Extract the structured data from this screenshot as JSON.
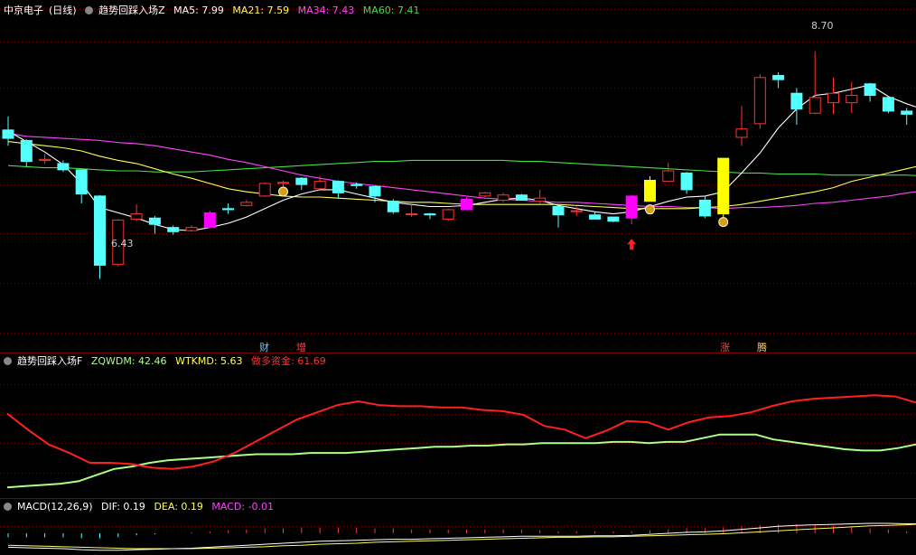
{
  "header1": {
    "stock": "中京电子",
    "period": "(日线)",
    "indicator": "趋势回踩入场Z",
    "ma5": "MA5: 7.99",
    "ma21": "MA21: 7.59",
    "ma34": "MA34: 7.43",
    "ma60": "MA60: 7.41"
  },
  "header2": {
    "indicator": "趋势回踩入场F",
    "zqwdm": "ZQWDM: 42.46",
    "wtkmd": "WTKMD: 5.63",
    "funds": "做多资金: 61.69"
  },
  "header3": {
    "indicator": "MACD(12,26,9)",
    "dif": "DIF: 0.19",
    "dea": "DEA: 0.19",
    "macd": "MACD: -0.01"
  },
  "tags": {
    "cai": "财",
    "zeng": "增",
    "zhang": "涨",
    "teng": "腾"
  },
  "colors": {
    "up": "#ff3333",
    "down": "#54ffff",
    "ma5": "#ffffff",
    "ma21": "#ffff55",
    "ma34": "#ff44ff",
    "ma60": "#44dd44",
    "grid": "#7a0000",
    "funds": "#ff2020",
    "zqwdm": "#aaff88"
  },
  "chart_data": [
    {
      "type": "candlestick",
      "ylim": [
        5.9,
        8.9
      ],
      "annotations": {
        "high": "8.70",
        "low": "6.43"
      },
      "candles": [
        [
          7.85,
          7.77,
          7.98,
          7.7
        ],
        [
          7.75,
          7.55,
          7.76,
          7.5
        ],
        [
          7.56,
          7.57,
          7.62,
          7.53
        ],
        [
          7.53,
          7.47,
          7.56,
          7.45
        ],
        [
          7.47,
          7.24,
          7.48,
          7.15
        ],
        [
          7.22,
          6.56,
          7.23,
          6.43
        ],
        [
          6.57,
          6.99,
          7.0,
          6.55
        ],
        [
          7.0,
          7.05,
          7.14,
          6.98
        ],
        [
          7.01,
          6.95,
          7.03,
          6.86
        ],
        [
          6.92,
          6.88,
          6.94,
          6.85
        ],
        [
          6.89,
          6.92,
          6.94,
          6.89
        ],
        [
          6.92,
          7.06,
          7.08,
          6.92
        ],
        [
          7.1,
          7.09,
          7.15,
          7.05
        ],
        [
          7.13,
          7.16,
          7.18,
          7.12
        ],
        [
          7.22,
          7.34,
          7.35,
          7.21
        ],
        [
          7.34,
          7.35,
          7.37,
          7.31
        ],
        [
          7.39,
          7.33,
          7.4,
          7.28
        ],
        [
          7.29,
          7.36,
          7.41,
          7.28
        ],
        [
          7.36,
          7.25,
          7.37,
          7.2
        ],
        [
          7.33,
          7.32,
          7.35,
          7.29
        ],
        [
          7.31,
          7.22,
          7.32,
          7.16
        ],
        [
          7.17,
          7.07,
          7.19,
          7.05
        ],
        [
          7.05,
          7.05,
          7.14,
          7.02
        ],
        [
          7.05,
          7.04,
          7.06,
          7.0
        ],
        [
          7.0,
          7.09,
          7.1,
          6.98
        ],
        [
          7.09,
          7.19,
          7.21,
          7.09
        ],
        [
          7.22,
          7.25,
          7.26,
          7.21
        ],
        [
          7.18,
          7.23,
          7.25,
          7.16
        ],
        [
          7.23,
          7.18,
          7.24,
          7.18
        ],
        [
          7.17,
          7.2,
          7.28,
          7.15
        ],
        [
          7.12,
          7.04,
          7.14,
          6.92
        ],
        [
          7.08,
          7.08,
          7.12,
          7.03
        ],
        [
          7.04,
          7.0,
          7.07,
          7.0
        ],
        [
          7.02,
          6.98,
          7.02,
          6.97
        ],
        [
          7.01,
          7.22,
          7.23,
          6.95
        ],
        [
          7.17,
          7.37,
          7.41,
          7.17
        ],
        [
          7.36,
          7.46,
          7.54,
          7.36
        ],
        [
          7.44,
          7.28,
          7.45,
          7.24
        ],
        [
          7.18,
          7.03,
          7.22,
          7.01
        ],
        [
          7.05,
          7.58,
          7.58,
          7.0
        ],
        [
          7.78,
          7.86,
          8.08,
          7.7
        ],
        [
          7.91,
          8.35,
          8.38,
          7.86
        ],
        [
          8.37,
          8.33,
          8.4,
          8.25
        ],
        [
          8.2,
          8.05,
          8.25,
          7.9
        ],
        [
          8.01,
          8.16,
          8.6,
          8.0
        ],
        [
          8.11,
          8.2,
          8.35,
          8.0
        ],
        [
          8.11,
          8.18,
          8.31,
          8.01
        ],
        [
          8.29,
          8.18,
          8.3,
          8.12
        ],
        [
          8.16,
          8.03,
          8.17,
          8.01
        ],
        [
          8.03,
          8.0,
          8.06,
          7.9
        ],
        [
          7.9,
          7.8,
          7.98,
          7.35
        ]
      ],
      "ma5": [
        7.84,
        7.74,
        7.64,
        7.52,
        7.34,
        7.11,
        7.06,
        7.01,
        6.95,
        6.9,
        6.89,
        6.92,
        6.96,
        7.02,
        7.1,
        7.18,
        7.24,
        7.28,
        7.28,
        7.24,
        7.2,
        7.16,
        7.14,
        7.12,
        7.12,
        7.13,
        7.16,
        7.19,
        7.2,
        7.18,
        7.13,
        7.1,
        7.07,
        7.05,
        7.07,
        7.12,
        7.17,
        7.21,
        7.22,
        7.26,
        7.44,
        7.63,
        7.87,
        8.05,
        8.18,
        8.2,
        8.24,
        8.28,
        8.17,
        8.1,
        8.04
      ],
      "ma21": [
        7.74,
        7.72,
        7.7,
        7.68,
        7.65,
        7.6,
        7.56,
        7.53,
        7.48,
        7.43,
        7.39,
        7.34,
        7.29,
        7.26,
        7.24,
        7.22,
        7.21,
        7.21,
        7.2,
        7.19,
        7.18,
        7.17,
        7.16,
        7.16,
        7.15,
        7.14,
        7.14,
        7.14,
        7.14,
        7.14,
        7.14,
        7.13,
        7.12,
        7.11,
        7.1,
        7.1,
        7.1,
        7.1,
        7.11,
        7.12,
        7.14,
        7.17,
        7.2,
        7.23,
        7.26,
        7.3,
        7.36,
        7.4,
        7.44,
        7.48,
        7.52
      ],
      "ma34": [
        7.82,
        7.79,
        7.78,
        7.77,
        7.76,
        7.75,
        7.73,
        7.72,
        7.7,
        7.67,
        7.64,
        7.61,
        7.57,
        7.54,
        7.5,
        7.46,
        7.42,
        7.39,
        7.36,
        7.34,
        7.32,
        7.3,
        7.28,
        7.26,
        7.24,
        7.22,
        7.2,
        7.19,
        7.18,
        7.17,
        7.16,
        7.16,
        7.15,
        7.14,
        7.13,
        7.12,
        7.12,
        7.11,
        7.11,
        7.1,
        7.11,
        7.11,
        7.12,
        7.13,
        7.15,
        7.16,
        7.18,
        7.2,
        7.22,
        7.25,
        7.27
      ],
      "ma60": [
        7.51,
        7.5,
        7.49,
        7.49,
        7.48,
        7.47,
        7.46,
        7.46,
        7.45,
        7.45,
        7.45,
        7.46,
        7.47,
        7.48,
        7.49,
        7.5,
        7.51,
        7.52,
        7.53,
        7.54,
        7.55,
        7.55,
        7.56,
        7.56,
        7.56,
        7.56,
        7.56,
        7.56,
        7.55,
        7.55,
        7.54,
        7.53,
        7.52,
        7.51,
        7.5,
        7.49,
        7.48,
        7.47,
        7.46,
        7.45,
        7.44,
        7.44,
        7.43,
        7.43,
        7.43,
        7.42,
        7.42,
        7.42,
        7.42,
        7.42,
        7.41
      ],
      "markers": {
        "money": [
          15,
          35,
          39
        ],
        "arrow": [
          34
        ]
      }
    },
    {
      "type": "line",
      "ylim": [
        0,
        100
      ],
      "series": [
        {
          "name": "ZQWDM",
          "values": [
            5,
            6,
            7,
            8,
            10,
            15,
            20,
            22,
            25,
            27,
            28,
            29,
            30,
            31,
            32,
            32,
            32,
            33,
            33,
            33,
            34,
            35,
            36,
            37,
            38,
            38,
            39,
            39,
            40,
            40,
            41,
            41,
            41,
            41,
            42,
            42,
            41,
            42,
            42,
            45,
            48,
            48,
            48,
            44,
            42,
            40,
            38,
            36,
            35,
            35,
            37,
            40
          ]
        },
        {
          "name": "做多资金",
          "values": [
            65,
            52,
            40,
            33,
            25,
            25,
            24,
            21,
            20,
            22,
            26,
            33,
            42,
            51,
            60,
            66,
            72,
            75,
            72,
            71,
            71,
            70,
            70,
            68,
            67,
            64,
            55,
            52,
            45,
            51,
            59,
            58,
            52,
            58,
            62,
            63,
            66,
            71,
            75,
            77,
            78,
            79,
            80,
            79,
            74
          ]
        }
      ]
    },
    {
      "type": "bar",
      "ylim": [
        -0.4,
        0.4
      ],
      "dif": [
        -0.28,
        -0.29,
        -0.3,
        -0.31,
        -0.33,
        -0.34,
        -0.34,
        -0.33,
        -0.32,
        -0.31,
        -0.3,
        -0.28,
        -0.26,
        -0.24,
        -0.22,
        -0.2,
        -0.18,
        -0.16,
        -0.15,
        -0.14,
        -0.13,
        -0.12,
        -0.12,
        -0.11,
        -0.1,
        -0.09,
        -0.08,
        -0.07,
        -0.06,
        -0.06,
        -0.06,
        -0.06,
        -0.05,
        -0.05,
        -0.04,
        -0.02,
        0.0,
        0.02,
        0.03,
        0.05,
        0.08,
        0.11,
        0.14,
        0.16,
        0.17,
        0.18,
        0.19,
        0.2,
        0.2,
        0.19,
        0.19
      ],
      "dea": [
        -0.24,
        -0.25,
        -0.26,
        -0.27,
        -0.28,
        -0.29,
        -0.3,
        -0.31,
        -0.31,
        -0.31,
        -0.31,
        -0.3,
        -0.29,
        -0.28,
        -0.27,
        -0.25,
        -0.24,
        -0.22,
        -0.21,
        -0.2,
        -0.18,
        -0.17,
        -0.16,
        -0.15,
        -0.14,
        -0.13,
        -0.12,
        -0.11,
        -0.1,
        -0.09,
        -0.08,
        -0.08,
        -0.07,
        -0.07,
        -0.06,
        -0.05,
        -0.04,
        -0.03,
        -0.02,
        -0.01,
        0.01,
        0.03,
        0.05,
        0.07,
        0.09,
        0.11,
        0.13,
        0.15,
        0.16,
        0.17,
        0.19
      ],
      "macd": [
        -0.08,
        -0.08,
        -0.08,
        -0.08,
        -0.1,
        -0.1,
        -0.08,
        -0.04,
        -0.02,
        0.0,
        0.02,
        0.04,
        0.06,
        0.08,
        0.1,
        0.1,
        0.12,
        0.12,
        0.12,
        0.12,
        0.1,
        0.1,
        0.08,
        0.08,
        0.08,
        0.08,
        0.08,
        0.08,
        0.08,
        0.06,
        0.04,
        0.04,
        0.04,
        0.04,
        0.04,
        0.06,
        0.08,
        0.1,
        0.1,
        0.12,
        0.14,
        0.16,
        0.18,
        0.18,
        0.16,
        0.14,
        0.12,
        0.1,
        0.08,
        0.04,
        -0.01
      ]
    }
  ]
}
